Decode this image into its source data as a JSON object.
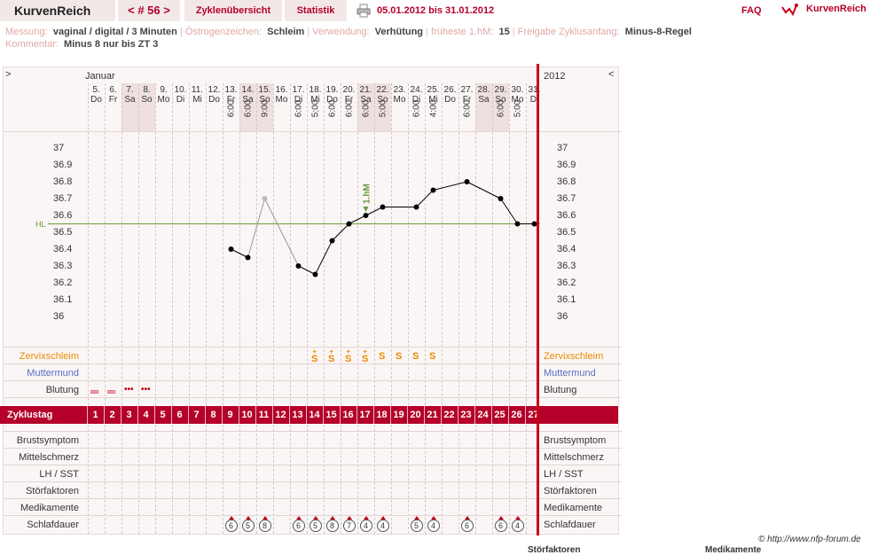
{
  "header": {
    "brand": "KurvenReich",
    "cycle_nav": "< # 56 >",
    "tab_overview": "Zyklenübersicht",
    "tab_stats": "Statistik",
    "date_range": "05.01.2012 bis 31.01.2012",
    "faq": "FAQ",
    "logo_text": "KurvenReich"
  },
  "info": {
    "messung_label": "Messung:",
    "messung_value": "vaginal / digital / 3 Minuten",
    "oestrogen_label": "Östrogenzeichen:",
    "oestrogen_value": "Schleim",
    "verwendung_label": "Verwendung:",
    "verwendung_value": "Verhütung",
    "hm_label": "früheste 1.hM:",
    "hm_value": "15",
    "freigabe_label": "Freigabe Zyklusanfang:",
    "freigabe_value": "Minus-8-Regel",
    "kommentar_label": "Kommentar:",
    "kommentar_value": "Minus 8 nur bis ZT 3"
  },
  "chart": {
    "nav_left": ">",
    "nav_right": "<",
    "month": "Januar",
    "year": "2012",
    "hl_label": "HL",
    "marker_label": "1.hM",
    "rows_label": {
      "zervix": "Zervixschleim",
      "muttermund": "Muttermund",
      "blutung": "Blutung",
      "zyklustag": "Zyklustag",
      "brust": "Brustsymptom",
      "mittel": "Mittelschmerz",
      "lh": "LH / SST",
      "stoer": "Störfaktoren",
      "medi": "Medikamente",
      "schlaf": "Schlafdauer"
    },
    "y_ticks": [
      "37",
      "36.9",
      "36.8",
      "36.7",
      "36.6",
      "36.5",
      "36.4",
      "36.3",
      "36.2",
      "36.1",
      "36"
    ],
    "days": [
      {
        "d": "5.",
        "w": "Do",
        "t": "",
        "shade": false
      },
      {
        "d": "6.",
        "w": "Fr",
        "t": "",
        "shade": false
      },
      {
        "d": "7.",
        "w": "Sa",
        "t": "",
        "shade": true
      },
      {
        "d": "8.",
        "w": "So",
        "t": "",
        "shade": true
      },
      {
        "d": "9.",
        "w": "Mo",
        "t": "",
        "shade": false
      },
      {
        "d": "10.",
        "w": "Di",
        "t": "",
        "shade": false
      },
      {
        "d": "11.",
        "w": "Mi",
        "t": "",
        "shade": false
      },
      {
        "d": "12.",
        "w": "Do",
        "t": "",
        "shade": false
      },
      {
        "d": "13.",
        "w": "Fr",
        "t": "6:00",
        "shade": false
      },
      {
        "d": "14.",
        "w": "Sa",
        "t": "6:00",
        "shade": true
      },
      {
        "d": "15.",
        "w": "So",
        "t": "9:00",
        "shade": true
      },
      {
        "d": "16.",
        "w": "Mo",
        "t": "",
        "shade": false
      },
      {
        "d": "17.",
        "w": "Di",
        "t": "6:00",
        "shade": false
      },
      {
        "d": "18.",
        "w": "Mi",
        "t": "5:00",
        "shade": false
      },
      {
        "d": "19.",
        "w": "Do",
        "t": "6:00",
        "shade": false
      },
      {
        "d": "20.",
        "w": "Fr",
        "t": "6:00",
        "shade": false
      },
      {
        "d": "21.",
        "w": "Sa",
        "t": "6:00",
        "shade": true
      },
      {
        "d": "22.",
        "w": "So",
        "t": "5:00",
        "shade": true
      },
      {
        "d": "23.",
        "w": "Mo",
        "t": "",
        "shade": false
      },
      {
        "d": "24.",
        "w": "Di",
        "t": "6:00",
        "shade": false
      },
      {
        "d": "25.",
        "w": "Mi",
        "t": "4:00",
        "shade": false
      },
      {
        "d": "26.",
        "w": "Do",
        "t": "",
        "shade": false
      },
      {
        "d": "27.",
        "w": "Fr",
        "t": "6:00",
        "shade": false
      },
      {
        "d": "28.",
        "w": "Sa",
        "t": "",
        "shade": true
      },
      {
        "d": "29.",
        "w": "So",
        "t": "6:00",
        "shade": true
      },
      {
        "d": "30.",
        "w": "Mo",
        "t": "5:00",
        "shade": false
      },
      {
        "d": "31.",
        "w": "Di",
        "t": "",
        "shade": false
      }
    ],
    "cycle_days": [
      "1",
      "2",
      "3",
      "4",
      "5",
      "6",
      "7",
      "8",
      "9",
      "10",
      "11",
      "12",
      "13",
      "14",
      "15",
      "16",
      "17",
      "18",
      "19",
      "20",
      "21",
      "22",
      "23",
      "24",
      "25",
      "26",
      "27"
    ],
    "mucus": [
      "",
      "",
      "",
      "",
      "",
      "",
      "",
      "",
      "",
      "",
      "",
      "",
      "",
      "S+",
      "S+",
      "S+",
      "S+",
      "S",
      "S",
      "S",
      "S",
      "",
      "",
      "",
      "",
      "",
      ""
    ],
    "bleeding": [
      "heavy",
      "heavy",
      "light",
      "light",
      "",
      "",
      "",
      "",
      "",
      "",
      "",
      "",
      "",
      "",
      "",
      "",
      "",
      "",
      "",
      "",
      "",
      "",
      "",
      "",
      "",
      "",
      ""
    ],
    "sleep": [
      "",
      "",
      "",
      "",
      "",
      "",
      "",
      "",
      "6",
      "5",
      "8",
      "",
      "6",
      "5",
      "8",
      "7",
      "4",
      "4",
      "",
      "5",
      "4",
      "",
      "6",
      "",
      "6",
      "4",
      ""
    ]
  },
  "chart_data": {
    "type": "line",
    "title": "",
    "xlabel": "",
    "ylabel": "",
    "ylim": [
      36,
      37
    ],
    "coverline": 36.55,
    "first_higher_measurement_day": 17,
    "series": [
      {
        "values": [
          null,
          null,
          null,
          null,
          null,
          null,
          null,
          null,
          36.4,
          36.35,
          36.7,
          null,
          36.3,
          36.25,
          36.45,
          36.55,
          36.6,
          36.65,
          null,
          36.65,
          36.75,
          null,
          36.8,
          null,
          36.7,
          36.55,
          36.55
        ],
        "excluded_index": 10
      }
    ]
  },
  "footer": {
    "copyright": "© http://www.nfp-forum.de",
    "cut1": "Störfaktoren",
    "cut2": "Medikamente"
  },
  "colors": {
    "accent": "#b5002a",
    "mucus": "#e88a00",
    "muttermund": "#5a6fc0",
    "coverline": "#6a9a3a"
  }
}
